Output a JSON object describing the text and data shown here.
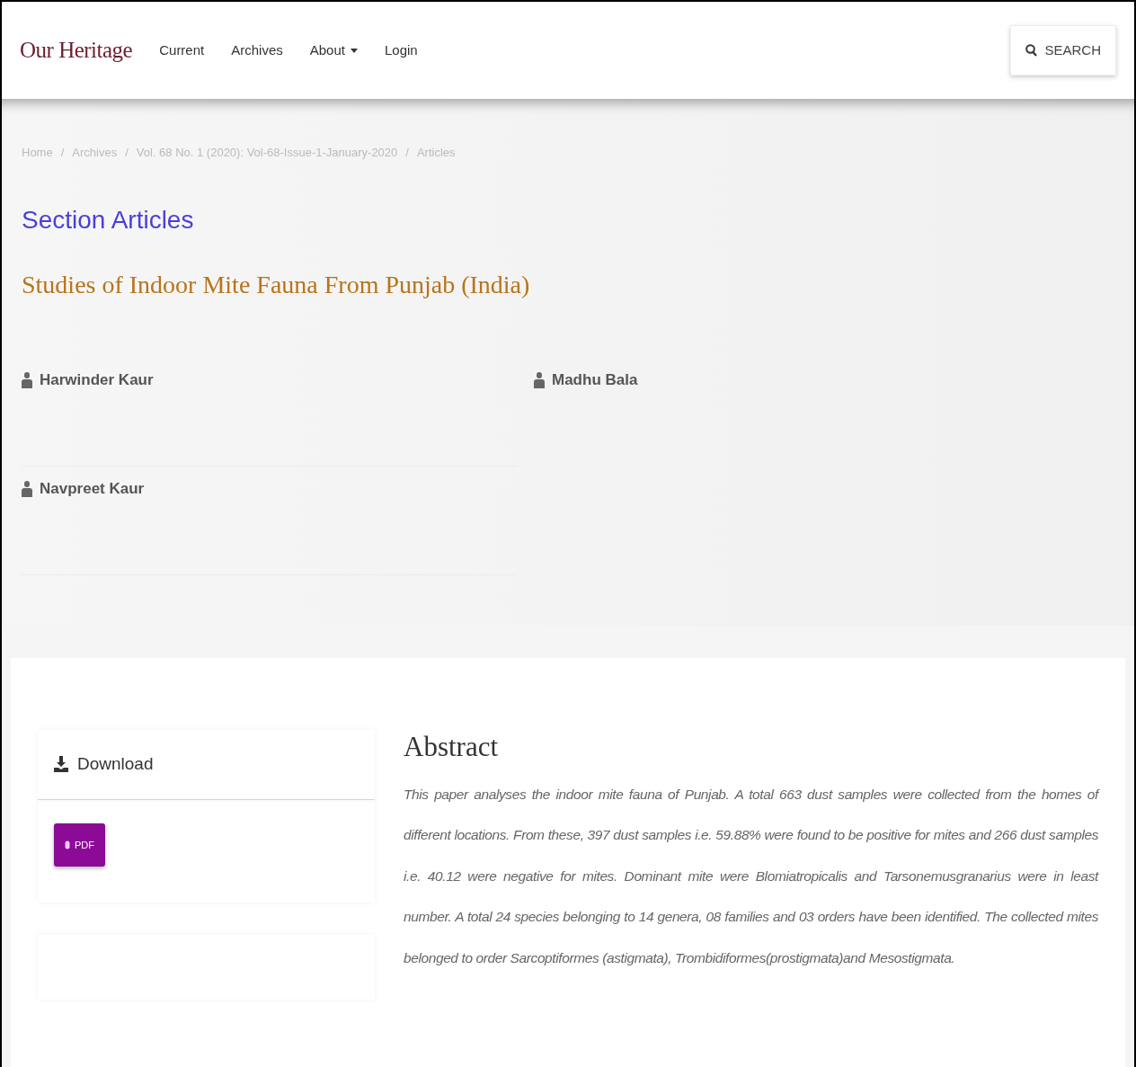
{
  "navbar": {
    "brand": "Our Heritage",
    "links": [
      {
        "label": "Current",
        "dropdown": false
      },
      {
        "label": "Archives",
        "dropdown": false
      },
      {
        "label": "About",
        "dropdown": true
      },
      {
        "label": "Login",
        "dropdown": false
      }
    ],
    "search": "SEARCH"
  },
  "breadcrumb": {
    "separator": "/",
    "items": [
      "Home",
      "Archives",
      "Vol. 68 No. 1 (2020): Vol-68-Issue-1-January-2020",
      "Articles"
    ]
  },
  "section_title": "Section Articles",
  "article_title": "Studies of Indoor Mite Fauna From Punjab (India)",
  "authors": [
    "Harwinder Kaur",
    "Madhu Bala",
    "Navpreet Kaur"
  ],
  "download": {
    "title": "Download",
    "button": "PDF"
  },
  "abstract": {
    "title": "Abstract",
    "text": "This paper analyses the indoor mite fauna of Punjab. A total 663 dust samples were collected from the homes of different locations. From these, 397 dust samples i.e. 59.88% were found to be positive for mites and 266 dust samples i.e. 40.12 were negative for mites. Dominant mite were Blomiatropicalis and Tarsonemusgranarius were in least number. A total 24 species belonging to 14 genera, 08 families and 03 orders have been identified. The collected mites belonged to order Sarcoptiformes (astigmata), Trombidiformes(prostigmata)and Mesostigmata."
  }
}
